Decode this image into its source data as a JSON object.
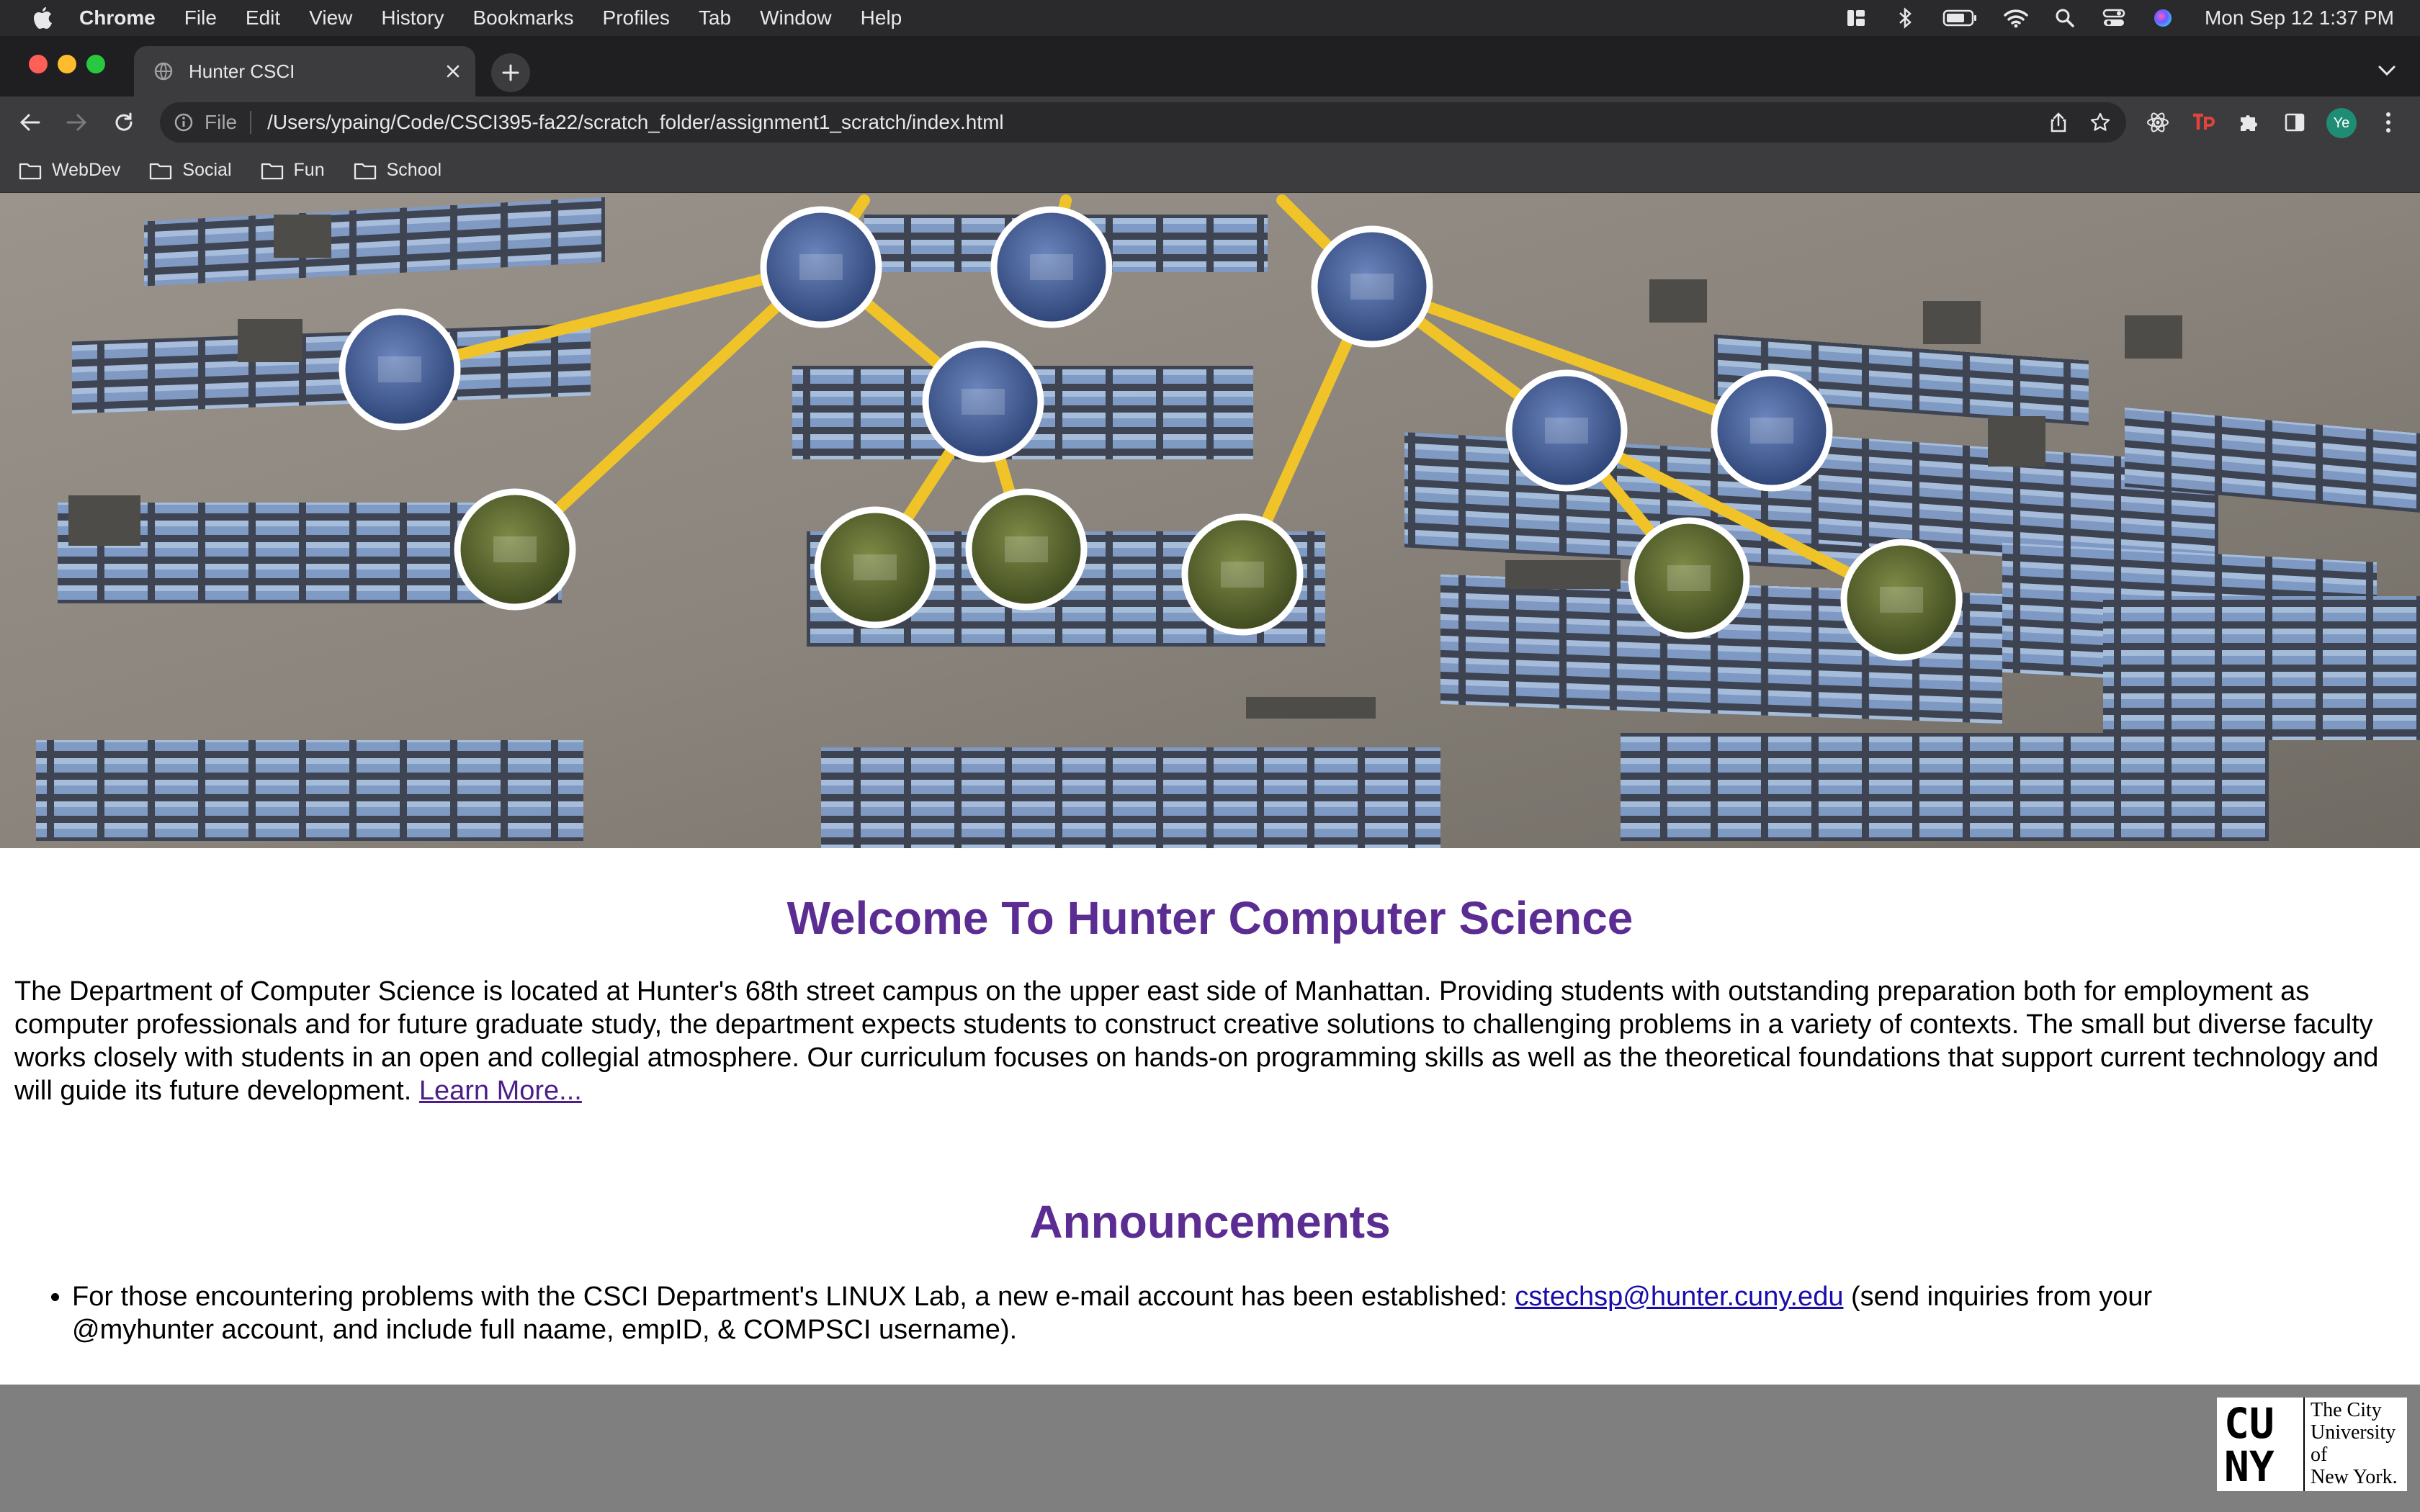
{
  "menubar": {
    "app_name": "Chrome",
    "items": [
      "File",
      "Edit",
      "View",
      "History",
      "Bookmarks",
      "Profiles",
      "Tab",
      "Window",
      "Help"
    ],
    "clock": "Mon Sep 12  1:37 PM"
  },
  "tab": {
    "title": "Hunter CSCI"
  },
  "omnibox": {
    "scheme": "File",
    "url": "/Users/ypaing/Code/CSCI395-fa22/scratch_folder/assignment1_scratch/index.html"
  },
  "profile": {
    "initials": "Ye"
  },
  "bookmarks": [
    "WebDev",
    "Social",
    "Fun",
    "School"
  ],
  "page": {
    "heading": "Welcome To Hunter Computer Science",
    "intro": "The Department of Computer Science is located at Hunter's 68th street campus on the upper east side of Manhattan. Providing students with outstanding preparation both for employment as computer professionals and for future graduate study, the department expects students to construct creative solutions to challenging problems in a variety of contexts. The small but diverse faculty works closely with students in an open and collegial atmosphere. Our curriculum focuses on hands-on programming skills as well as the theoretical foundations that support current technology and will guide its future development.",
    "learn_more": "Learn More...",
    "announcements_heading": "Announcements",
    "announcement_text_before": "For those encountering problems with the CSCI Department's LINUX Lab, a new e-mail account has been established: ",
    "announcement_email": "cstechsp@hunter.cuny.edu",
    "announcement_text_after": " (send inquiries from your @myhunter account, and include full naame, empID, & COMPSCI username)."
  },
  "footer": {
    "logo_mark": [
      "CU",
      "NY"
    ],
    "logo_text": [
      "The City",
      "University",
      "of",
      "New York."
    ]
  },
  "colors": {
    "heading": "#5b2c91",
    "link": "#4b1f87",
    "footer_bg": "#7f7f7f",
    "tree_edge": "#f0c428",
    "tree_node_blue": "#3d5a96",
    "tree_node_green": "#5a6830"
  }
}
